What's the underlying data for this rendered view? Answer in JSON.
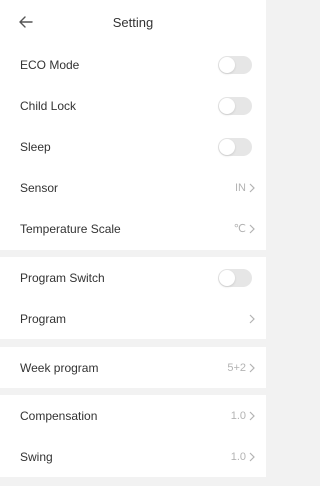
{
  "header": {
    "title": "Setting",
    "back_icon": "arrow-left-icon"
  },
  "groups": [
    {
      "items": [
        {
          "label": "ECO Mode",
          "type": "toggle",
          "on": false
        },
        {
          "label": "Child Lock",
          "type": "toggle",
          "on": false
        },
        {
          "label": "Sleep",
          "type": "toggle",
          "on": false
        },
        {
          "label": "Sensor",
          "type": "value",
          "value": "IN"
        },
        {
          "label": "Temperature Scale",
          "type": "value",
          "value": "℃"
        }
      ]
    },
    {
      "items": [
        {
          "label": "Program Switch",
          "type": "toggle",
          "on": false
        },
        {
          "label": "Program",
          "type": "value",
          "value": ""
        }
      ]
    },
    {
      "items": [
        {
          "label": "Week program",
          "type": "value",
          "value": "5+2"
        }
      ]
    },
    {
      "items": [
        {
          "label": "Compensation",
          "type": "value",
          "value": "1.0"
        },
        {
          "label": "Swing",
          "type": "value",
          "value": "1.0"
        }
      ]
    }
  ],
  "colors": {
    "toggle_off": "#e6e6e6",
    "value_text": "#b3b3b3",
    "divider_bg": "#f2f2f2"
  }
}
